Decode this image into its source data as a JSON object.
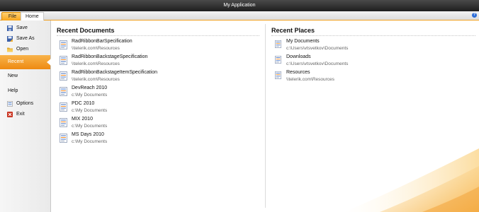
{
  "window": {
    "title": "My Application"
  },
  "tabs": [
    {
      "label": "File"
    },
    {
      "label": "Home"
    }
  ],
  "sidebar": {
    "items": [
      {
        "label": "Save",
        "icon": "save-icon"
      },
      {
        "label": "Save As",
        "icon": "save-as-icon"
      },
      {
        "label": "Open",
        "icon": "folder-open-icon"
      },
      {
        "label": "Recent",
        "icon": ""
      },
      {
        "label": "New",
        "icon": ""
      },
      {
        "label": "Help",
        "icon": ""
      },
      {
        "label": "Options",
        "icon": "options-icon"
      },
      {
        "label": "Exit",
        "icon": "exit-icon"
      }
    ],
    "active": "Recent"
  },
  "recent_documents": {
    "title": "Recent Documents",
    "items": [
      {
        "name": "RadRibbonBarSpecification",
        "path": "\\\\telerik.com\\Resources"
      },
      {
        "name": "RadRibbonBackstageSpecification",
        "path": "\\\\telerik.com\\Resources"
      },
      {
        "name": "RadRibbonBackstageItemSpecification",
        "path": "\\\\telerik.com\\Resources"
      },
      {
        "name": "DevReach 2010",
        "path": "c:\\My Documents"
      },
      {
        "name": "PDC 2010",
        "path": "c:\\My Documents"
      },
      {
        "name": "MIX 2010",
        "path": "c:\\My Documents"
      },
      {
        "name": "MS Days 2010",
        "path": "c:\\My Documents"
      }
    ]
  },
  "recent_places": {
    "title": "Recent Places",
    "items": [
      {
        "name": "My Documents",
        "path": "c:\\Users\\vtsvetkov\\Documents"
      },
      {
        "name": "Downloads",
        "path": "c:\\Users\\vtsvetkov\\Documents"
      },
      {
        "name": "Resources",
        "path": "\\\\telerik.com\\Resources"
      }
    ]
  },
  "colors": {
    "accent": "#f39a1e",
    "titlebar": "#2a2a2a"
  }
}
